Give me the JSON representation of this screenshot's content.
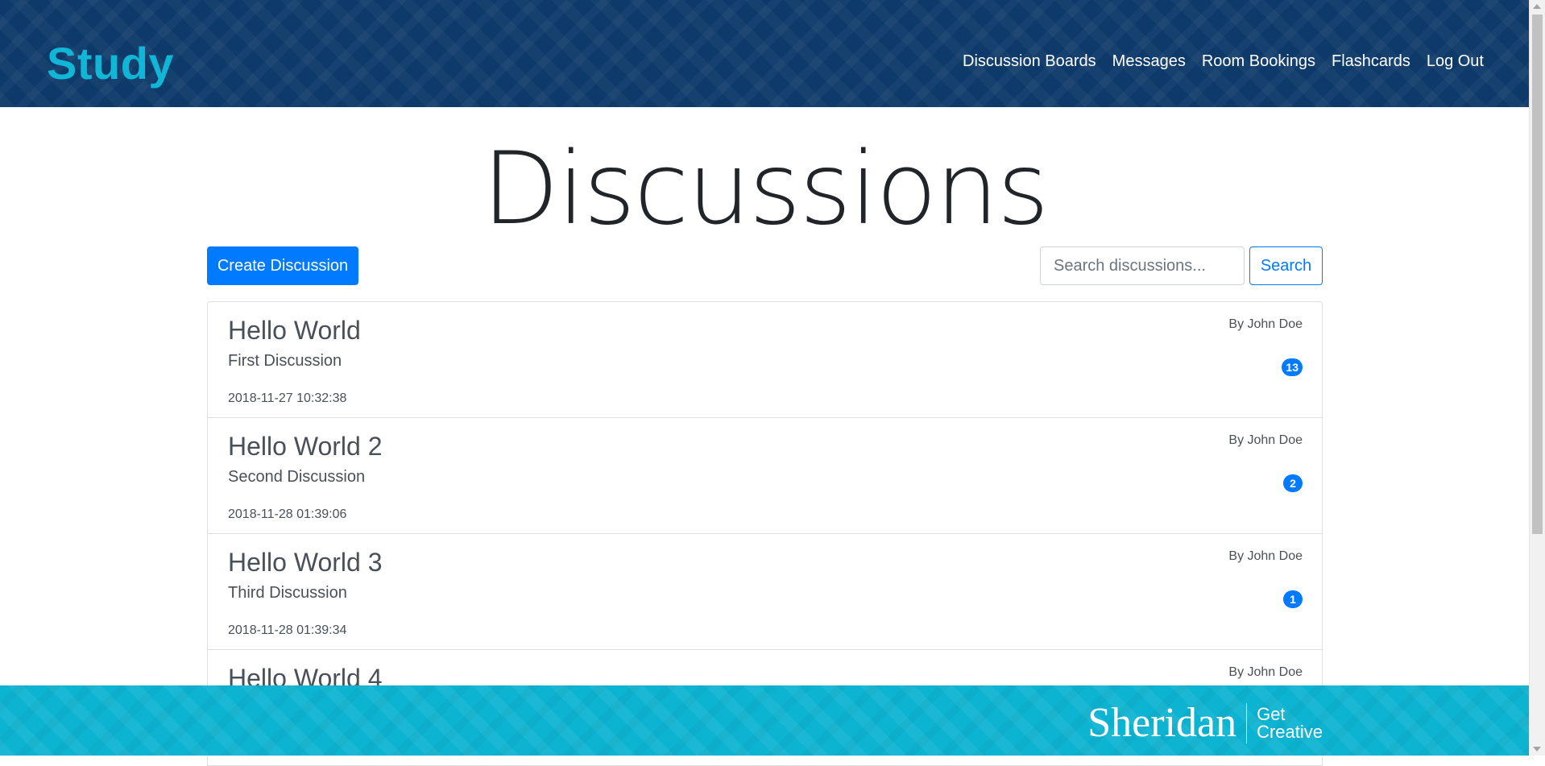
{
  "header": {
    "brand": "Study",
    "nav": [
      "Discussion Boards",
      "Messages",
      "Room Bookings",
      "Flashcards",
      "Log Out"
    ]
  },
  "main": {
    "title": "Discussions",
    "create_label": "Create Discussion",
    "search_placeholder": "Search discussions...",
    "search_label": "Search",
    "discussions": [
      {
        "title": "Hello World",
        "subtitle": "First Discussion",
        "date": "2018-11-27 10:32:38",
        "author": "By John Doe",
        "count": "13"
      },
      {
        "title": "Hello World 2",
        "subtitle": "Second Discussion",
        "date": "2018-11-28 01:39:06",
        "author": "By John Doe",
        "count": "2"
      },
      {
        "title": "Hello World 3",
        "subtitle": "Third Discussion",
        "date": "2018-11-28 01:39:34",
        "author": "By John Doe",
        "count": "1"
      },
      {
        "title": "Hello World 4",
        "subtitle": "",
        "date": "",
        "author": "By John Doe",
        "count": ""
      }
    ]
  },
  "footer": {
    "wordmark": "Sheridan",
    "tagline_line1": "Get",
    "tagline_line2": "Creative"
  },
  "colors": {
    "header_bg": "#0e3a6a",
    "brand": "#11b5d6",
    "primary": "#007bff",
    "footer_bg": "#0cb4d2"
  }
}
